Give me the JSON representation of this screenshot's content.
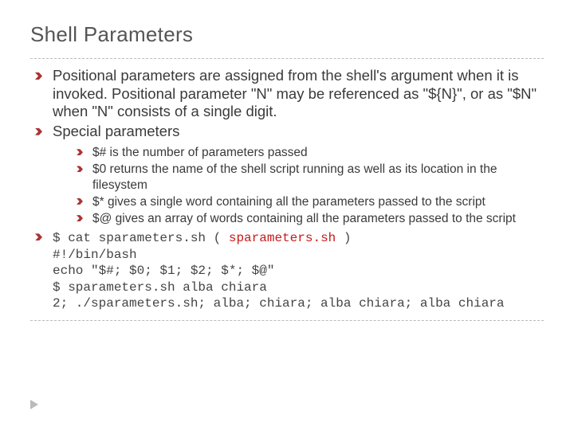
{
  "title": "Shell Parameters",
  "main": [
    "Positional parameters are assigned from the shell's argument when it is invoked. Positional parameter \"N\" may be referenced as \"${N}\", or as \"$N\" when \"N\" consists of a single digit.",
    "Special parameters"
  ],
  "sub": [
    "$# is the number of parameters passed",
    "$0 returns the name of the shell script running as well as its location in the filesystem",
    "$* gives a single word containing all the parameters passed to the script",
    "$@ gives an array of words containing all the parameters passed to the script"
  ],
  "code": {
    "l1a": "$ cat sparameters.sh ( ",
    "l1b": "sparameters.sh",
    "l1c": " )",
    "l2": "#!/bin/bash",
    "l3": "echo \"$#; $0; $1; $2; $*; $@\"",
    "l4": "$ sparameters.sh alba chiara",
    "l5": "2; ./sparameters.sh; alba; chiara; alba chiara; alba chiara"
  }
}
